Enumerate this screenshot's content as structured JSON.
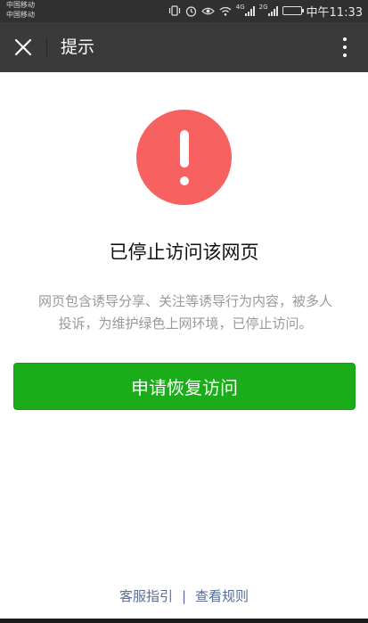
{
  "status_bar": {
    "carrier_1": "中国移动",
    "carrier_2": "中国移动",
    "network_1": "4G",
    "network_2": "2G",
    "time": "中午11:33",
    "battery_level": 0.8
  },
  "title_bar": {
    "title": "提示",
    "close_icon": "close-icon",
    "more_icon": "more-vertical-icon"
  },
  "notice": {
    "icon": "warning-icon",
    "icon_color": "#f76260",
    "heading": "已停止访问该网页",
    "description_line1": "网页包含诱导分享、关注等诱导行为内容，被多人",
    "description_line2": "投诉，为维护绿色上网环境，已停止访问。"
  },
  "actions": {
    "primary_button": "申请恢复访问",
    "primary_color": "#1aad19"
  },
  "footer": {
    "link_help": "客服指引",
    "separator": "|",
    "link_rules": "查看规则"
  }
}
